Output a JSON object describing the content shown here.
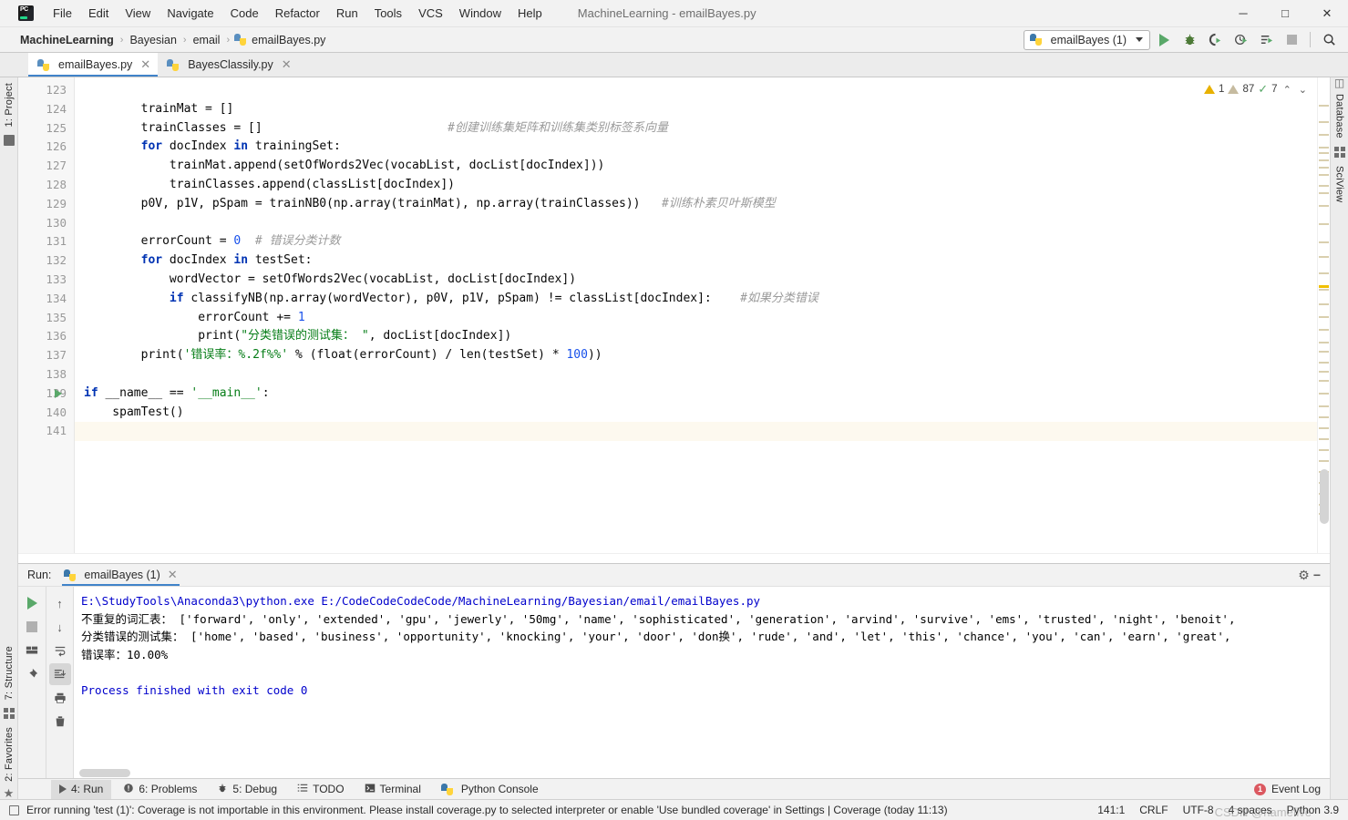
{
  "window": {
    "title": "MachineLearning - emailBayes.py",
    "logo_text": "PC",
    "minimize": "─",
    "maximize": "□",
    "close": "✕"
  },
  "menu": {
    "items": [
      "File",
      "Edit",
      "View",
      "Navigate",
      "Code",
      "Refactor",
      "Run",
      "Tools",
      "VCS",
      "Window",
      "Help"
    ]
  },
  "breadcrumb": {
    "items": [
      "MachineLearning",
      "Bayesian",
      "email",
      "emailBayes.py"
    ],
    "separator": "›"
  },
  "toolbar": {
    "run_config": "emailBayes (1)",
    "icons": [
      "run-icon",
      "debug-icon",
      "run-with-coverage-icon",
      "profile-icon",
      "run-tests-icon",
      "stop-icon",
      "search-icon"
    ]
  },
  "editor_tabs": [
    {
      "label": "emailBayes.py",
      "active": true,
      "close": "✕"
    },
    {
      "label": "BayesClassily.py",
      "active": false,
      "close": "✕"
    }
  ],
  "left_stripe": {
    "top": [
      "1: Project"
    ],
    "bottom": [
      "7: Structure",
      "2: Favorites"
    ]
  },
  "right_stripe": {
    "items": [
      "Database",
      "SciView"
    ]
  },
  "inspections": {
    "warning_count": "1",
    "weak_warning_count": "87",
    "ok_count": "7",
    "prev": "⌃",
    "next": "⌄"
  },
  "code": {
    "first_line_number": 123,
    "current_line": 141,
    "lines": [
      {
        "n": 123,
        "tokens": []
      },
      {
        "n": 124,
        "tokens": [
          {
            "t": "        trainMat = []",
            "c": "fn"
          }
        ]
      },
      {
        "n": 125,
        "tokens": [
          {
            "t": "        trainClasses = []",
            "c": "fn"
          },
          {
            "t": "                          ",
            "c": "fn"
          },
          {
            "t": "#创建训练集矩阵和训练集类别标签系向量",
            "c": "cmt-cn"
          }
        ],
        "fold": ""
      },
      {
        "n": 126,
        "tokens": [
          {
            "t": "        ",
            "c": "fn"
          },
          {
            "t": "for",
            "c": "kw"
          },
          {
            "t": " docIndex ",
            "c": "fn"
          },
          {
            "t": "in",
            "c": "kw"
          },
          {
            "t": " trainingSet:",
            "c": "fn"
          }
        ],
        "fold": "−"
      },
      {
        "n": 127,
        "tokens": [
          {
            "t": "            trainMat.append(setOfWords2Vec(vocabList, docList[docIndex]))",
            "c": "fn"
          }
        ]
      },
      {
        "n": 128,
        "tokens": [
          {
            "t": "            trainClasses.append(classList[docIndex])",
            "c": "fn"
          }
        ],
        "fold": "└"
      },
      {
        "n": 129,
        "tokens": [
          {
            "t": "        p0V, p1V, pSpam = trainNB0(np.array(trainMat), np.array(trainClasses))",
            "c": "fn"
          },
          {
            "t": "   ",
            "c": "fn"
          },
          {
            "t": "#训练朴素贝叶斯模型",
            "c": "cmt-cn"
          }
        ]
      },
      {
        "n": 130,
        "tokens": []
      },
      {
        "n": 131,
        "tokens": [
          {
            "t": "        errorCount = ",
            "c": "fn"
          },
          {
            "t": "0",
            "c": "num"
          },
          {
            "t": "  ",
            "c": "fn"
          },
          {
            "t": "# 错误分类计数",
            "c": "cmt-cn"
          }
        ]
      },
      {
        "n": 132,
        "tokens": [
          {
            "t": "        ",
            "c": "fn"
          },
          {
            "t": "for",
            "c": "kw"
          },
          {
            "t": " docIndex ",
            "c": "fn"
          },
          {
            "t": "in",
            "c": "kw"
          },
          {
            "t": " testSet:",
            "c": "fn"
          }
        ],
        "fold": "−"
      },
      {
        "n": 133,
        "tokens": [
          {
            "t": "            wordVector = setOfWords2Vec(vocabList, docList[docIndex])",
            "c": "fn"
          }
        ]
      },
      {
        "n": 134,
        "tokens": [
          {
            "t": "            ",
            "c": "fn"
          },
          {
            "t": "if",
            "c": "kw"
          },
          {
            "t": " classifyNB(np.array(wordVector), p0V, p1V, pSpam) != classList[docIndex]:",
            "c": "fn"
          },
          {
            "t": "    ",
            "c": "fn"
          },
          {
            "t": "#如果分类错误",
            "c": "cmt-cn"
          }
        ],
        "fold": "−"
      },
      {
        "n": 135,
        "tokens": [
          {
            "t": "                errorCount += ",
            "c": "fn"
          },
          {
            "t": "1",
            "c": "num"
          }
        ]
      },
      {
        "n": 136,
        "tokens": [
          {
            "t": "                ",
            "c": "fn"
          },
          {
            "t": "print",
            "c": "fn2"
          },
          {
            "t": "(",
            "c": "fn"
          },
          {
            "t": "\"分类错误的测试集： \"",
            "c": "str"
          },
          {
            "t": ", docList[docIndex])",
            "c": "fn"
          }
        ],
        "fold": "└"
      },
      {
        "n": 137,
        "tokens": [
          {
            "t": "        ",
            "c": "fn"
          },
          {
            "t": "print",
            "c": "fn2"
          },
          {
            "t": "(",
            "c": "fn"
          },
          {
            "t": "'错误率：%.2f%%'",
            "c": "str"
          },
          {
            "t": " % (",
            "c": "fn"
          },
          {
            "t": "float",
            "c": "fn2"
          },
          {
            "t": "(errorCount) / ",
            "c": "fn"
          },
          {
            "t": "len",
            "c": "fn2"
          },
          {
            "t": "(testSet) * ",
            "c": "fn"
          },
          {
            "t": "100",
            "c": "num"
          },
          {
            "t": "))",
            "c": "fn"
          }
        ],
        "fold": "└"
      },
      {
        "n": 138,
        "tokens": []
      },
      {
        "n": 139,
        "tokens": [
          {
            "t": "",
            "c": "fn"
          },
          {
            "t": "if",
            "c": "kw"
          },
          {
            "t": " __name__ == ",
            "c": "fn"
          },
          {
            "t": "'__main__'",
            "c": "str"
          },
          {
            "t": ":",
            "c": "fn"
          }
        ],
        "runmark": true
      },
      {
        "n": 140,
        "tokens": [
          {
            "t": "    spamTest()",
            "c": "fn"
          }
        ]
      },
      {
        "n": 141,
        "tokens": [],
        "current": true
      }
    ]
  },
  "run_window": {
    "label": "Run:",
    "tab": "emailBayes (1)",
    "tab_close": "✕",
    "settings_icon": "gear-icon",
    "hide_icon": "minimize-icon",
    "left_tools": [
      "rerun-icon",
      "stop-icon",
      "layout-icon",
      "pin-icon"
    ],
    "right_tools": [
      "up-icon",
      "down-icon",
      "soft-wrap-icon",
      "scroll-to-end-icon",
      "print-icon",
      "clear-all-icon"
    ],
    "console": [
      {
        "kind": "command",
        "text": "E:\\StudyTools\\Anaconda3\\python.exe E:/CodeCodeCodeCode/MachineLearning/Bayesian/email/emailBayes.py"
      },
      {
        "kind": "output",
        "text": "不重复的词汇表： ['forward', 'only', 'extended', 'gpu', 'jewerly', '50mg', 'name', 'sophisticated', 'generation', 'arvind', 'survive', 'ems', 'trusted', 'night', 'benoit',"
      },
      {
        "kind": "output",
        "text": "分类错误的测试集： ['home', 'based', 'business', 'opportunity', 'knocking', 'your', 'door', 'don换', 'rude', 'and', 'let', 'this', 'chance', 'you', 'can', 'earn', 'great',"
      },
      {
        "kind": "output",
        "text": "错误率：10.00%"
      },
      {
        "kind": "blank",
        "text": " "
      },
      {
        "kind": "finished",
        "text": "Process finished with exit code 0"
      }
    ]
  },
  "bottom_bar": {
    "items": [
      {
        "label": "4: Run",
        "mnemonic": "4",
        "icon": "run-icon",
        "active": true
      },
      {
        "label": "6: Problems",
        "mnemonic": "6",
        "icon": "problems-icon",
        "active": false
      },
      {
        "label": "5: Debug",
        "mnemonic": "5",
        "icon": "debug-icon",
        "active": false
      },
      {
        "label": "TODO",
        "mnemonic": "",
        "icon": "todo-icon",
        "active": false
      },
      {
        "label": "Terminal",
        "mnemonic": "",
        "icon": "terminal-icon",
        "active": false
      },
      {
        "label": "Python Console",
        "mnemonic": "",
        "icon": "python-console-icon",
        "active": false
      }
    ],
    "event_log": "Event Log",
    "event_log_badge": "1"
  },
  "status_bar": {
    "message": "Error running 'test (1)': Coverage is not importable in this environment. Please install coverage.py to selected interpreter or enable 'Use bundled coverage' in Settings | Coverage (today 11:13)",
    "caret": "141:1",
    "line_separator": "CRLF",
    "encoding": "UTF-8",
    "indent": "4 spaces",
    "interpreter": "Python 3.9",
    "watermark": "CSDN @nameflve"
  }
}
